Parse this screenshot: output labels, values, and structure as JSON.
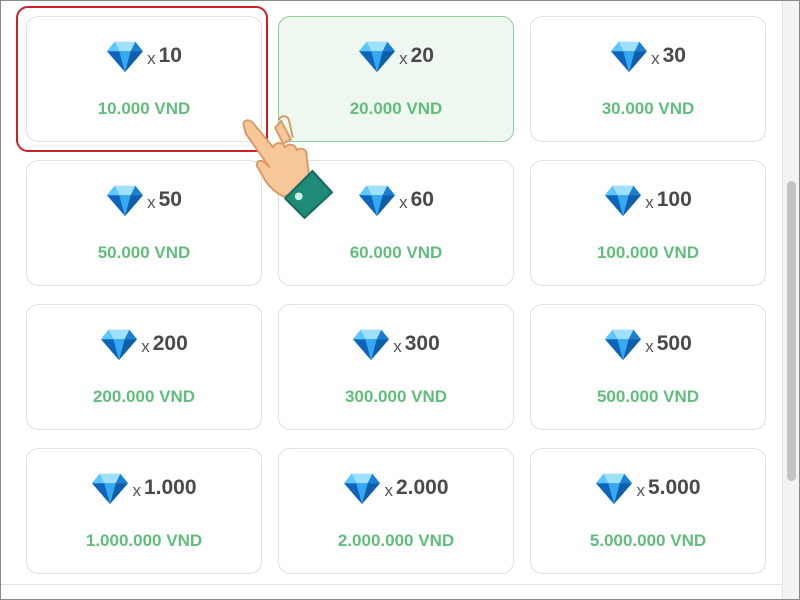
{
  "packages": [
    {
      "multiplier": "x",
      "quantity": "10",
      "price": "10.000 VND"
    },
    {
      "multiplier": "x",
      "quantity": "20",
      "price": "20.000 VND"
    },
    {
      "multiplier": "x",
      "quantity": "30",
      "price": "30.000 VND"
    },
    {
      "multiplier": "x",
      "quantity": "50",
      "price": "50.000 VND"
    },
    {
      "multiplier": "x",
      "quantity": "60",
      "price": "60.000 VND"
    },
    {
      "multiplier": "x",
      "quantity": "100",
      "price": "100.000 VND"
    },
    {
      "multiplier": "x",
      "quantity": "200",
      "price": "200.000 VND"
    },
    {
      "multiplier": "x",
      "quantity": "300",
      "price": "300.000 VND"
    },
    {
      "multiplier": "x",
      "quantity": "500",
      "price": "500.000 VND"
    },
    {
      "multiplier": "x",
      "quantity": "1.000",
      "price": "1.000.000 VND"
    },
    {
      "multiplier": "x",
      "quantity": "2.000",
      "price": "2.000.000 VND"
    },
    {
      "multiplier": "x",
      "quantity": "5.000",
      "price": "5.000.000 VND"
    }
  ],
  "colors": {
    "price_green": "#62bd7d",
    "selected_bg": "#eef8f0",
    "highlight_red": "#cc1f2c",
    "diamond_blue": "#1e8fe6"
  },
  "icons": {
    "package_icon": "diamond-icon",
    "pointer": "pointing-hand-icon"
  }
}
